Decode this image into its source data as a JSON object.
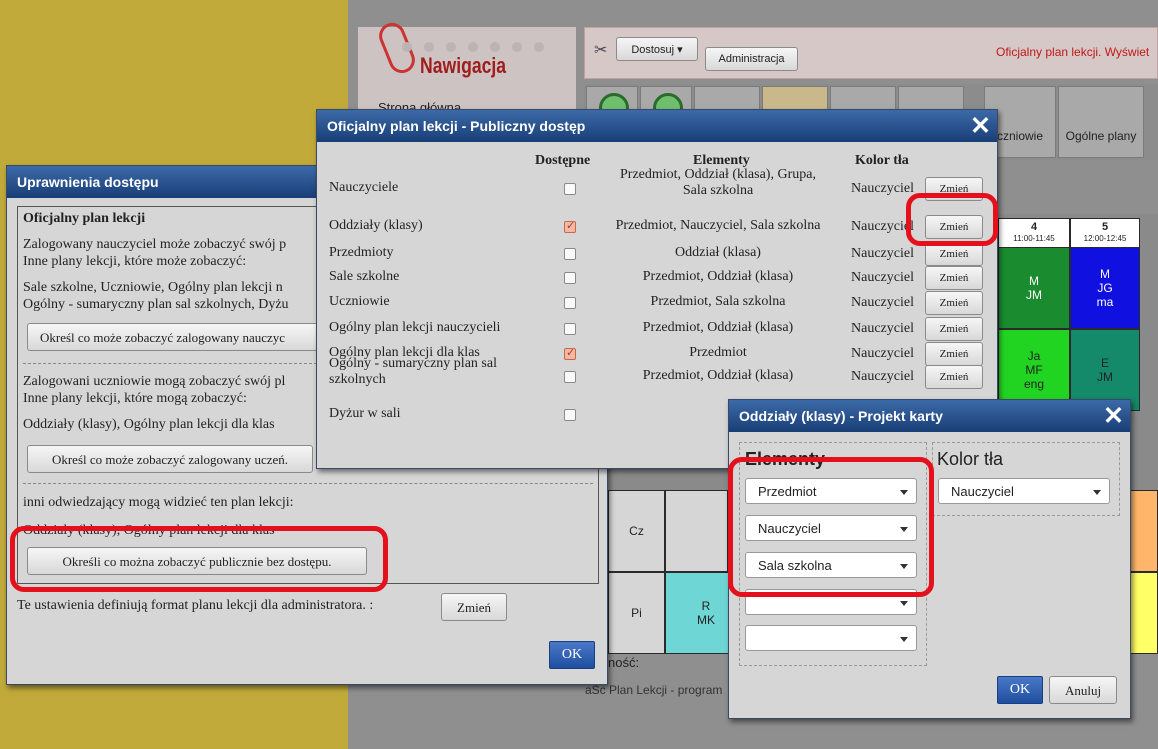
{
  "background": {
    "nav_title": "Nawigacja",
    "nav_link": "Strona główna",
    "toolbar_customize": "Dostosuj",
    "toolbar_admin": "Administracja",
    "toolbar_status": "Oficjalny plan lekcji.  Wyświet",
    "tiles": [
      "",
      "",
      "",
      "",
      "",
      "",
      "czniowie",
      "Ogólne plany"
    ],
    "grid": {
      "periods": [
        {
          "num": "4",
          "time": "11:00-11:45"
        },
        {
          "num": "5",
          "time": "12:00-12:45"
        }
      ],
      "days": [
        "Cz",
        "Pi"
      ],
      "cells": [
        {
          "text": [
            "M",
            "JM"
          ]
        },
        {
          "text": [
            "M",
            "JG",
            "ma"
          ]
        },
        {
          "text": [
            "Ja",
            "MF",
            "eng"
          ]
        },
        {
          "text": [
            "E",
            "JM"
          ]
        },
        {
          "text": [
            "R",
            "MK"
          ]
        }
      ]
    },
    "footer_text": "ność:",
    "footer_app": "aSc Plan Lekcji - program"
  },
  "access_dialog": {
    "title": "Uprawnienia dostępu",
    "section_title": "Oficjalny plan lekcji",
    "teacher_text_1": "Zalogowany nauczyciel może zobaczyć swój p",
    "teacher_text_2": "Inne plany lekcji, które może zobaczyć:",
    "teacher_list_1": "Sale szkolne, Uczniowie, Ogólny plan lekcji n",
    "teacher_list_2": "Ogólny - sumaryczny plan sal szkolnych, Dyżu",
    "teacher_button": "Określ co może zobaczyć zalogowany nauczyc",
    "student_text_1": "Zalogowani uczniowie mogą zobaczyć swój pl",
    "student_text_2": "Inne plany lekcji, które mogą zobaczyć:",
    "student_list": "Oddziały (klasy), Ogólny plan lekcji dla klas",
    "student_button": "Określ co może zobaczyć zalogowany uczeń.",
    "public_text": "inni odwiedzający mogą widzieć ten plan lekcji:",
    "public_list": "Oddziały (klasy), Ogólny plan lekcji dla klas",
    "public_button": "Określi co można zobaczyć publicznie bez dostępu.",
    "format_text": "Te ustawienia definiują format planu lekcji dla administratora. :",
    "format_button": "Zmień",
    "ok": "OK"
  },
  "public_dialog": {
    "title": "Oficjalny plan lekcji - Publiczny dostęp",
    "col_available": "Dostępne",
    "col_elements": "Elementy",
    "col_color": "Kolor tła",
    "change_label": "Zmień",
    "rows": [
      {
        "name": "Nauczyciele",
        "checked": false,
        "elements": [
          "Przedmiot, Oddział (klasa), Grupa,",
          "Sala szkolna"
        ],
        "color": "Nauczyciel"
      },
      {
        "name": "Oddziały (klasy)",
        "checked": true,
        "elements": [
          "Przedmiot, Nauczyciel, Sala szkolna"
        ],
        "color": "Nauczyciel"
      },
      {
        "name": "Przedmioty",
        "checked": false,
        "elements": [
          "Oddział (klasa)"
        ],
        "color": "Nauczyciel"
      },
      {
        "name": "Sale szkolne",
        "checked": false,
        "elements": [
          "Przedmiot, Oddział (klasa)"
        ],
        "color": "Nauczyciel"
      },
      {
        "name": "Uczniowie",
        "checked": false,
        "elements": [
          "Przedmiot, Sala szkolna"
        ],
        "color": "Nauczyciel"
      },
      {
        "name": "Ogólny plan lekcji nauczycieli",
        "checked": false,
        "elements": [
          "Przedmiot, Oddział (klasa)"
        ],
        "color": "Nauczyciel"
      },
      {
        "name": "Ogólny plan lekcji dla klas",
        "checked": true,
        "elements": [
          "Przedmiot"
        ],
        "color": "Nauczyciel"
      },
      {
        "name": "Ogólny - sumaryczny plan sal szkolnych",
        "checked": false,
        "elements": [
          "Przedmiot, Oddział (klasa)"
        ],
        "color": "Nauczyciel"
      },
      {
        "name": "Dyżur w sali",
        "checked": false,
        "elements": [],
        "color": ""
      }
    ]
  },
  "card_dialog": {
    "title": "Oddziały (klasy) - Projekt karty",
    "elements_header": "Elementy",
    "color_header": "Kolor tła",
    "element_selects": [
      "Przedmiot",
      "Nauczyciel",
      "Sala szkolna",
      "",
      ""
    ],
    "color_select": "Nauczyciel",
    "ok": "OK",
    "cancel": "Anuluj"
  },
  "colors": {
    "highlight": "#e4111d",
    "titlebar": "#1f4a8a"
  }
}
